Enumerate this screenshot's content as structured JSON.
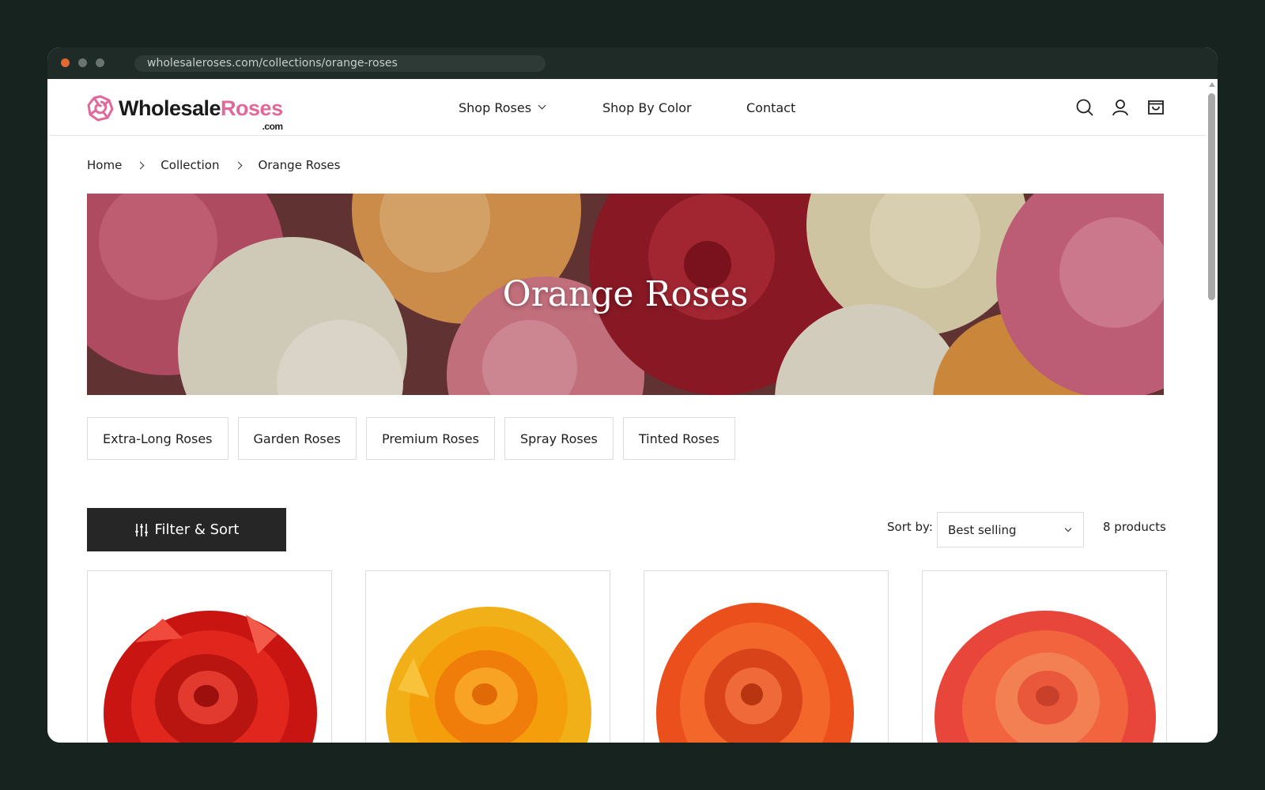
{
  "browser": {
    "url": "wholesaleroses.com/collections/orange-roses"
  },
  "header": {
    "logo": {
      "part1": "Wholesale",
      "part2": "Roses",
      "suffix": ".com"
    },
    "nav": {
      "shop_roses": "Shop Roses",
      "shop_by_color": "Shop By Color",
      "contact": "Contact"
    }
  },
  "breadcrumb": {
    "home": "Home",
    "collection": "Collection",
    "current": "Orange Roses"
  },
  "banner": {
    "title": "Orange Roses"
  },
  "subcollections": [
    "Extra-Long Roses",
    "Garden Roses",
    "Premium Roses",
    "Spray Roses",
    "Tinted Roses"
  ],
  "toolbar": {
    "filter_label": "Filter & Sort",
    "sort_label": "Sort by:",
    "sort_value": "Best selling",
    "product_count": "8 products"
  },
  "products": [
    {
      "image": "red-rose",
      "color": "#d8201c"
    },
    {
      "image": "yellow-orange-rose",
      "color": "#f3a414"
    },
    {
      "image": "orange-rose",
      "color": "#ee5a22"
    },
    {
      "image": "coral-orange-rose",
      "color": "#ef5b3a"
    }
  ],
  "colors": {
    "accent": "#e0689a",
    "dark_button": "#262626"
  }
}
